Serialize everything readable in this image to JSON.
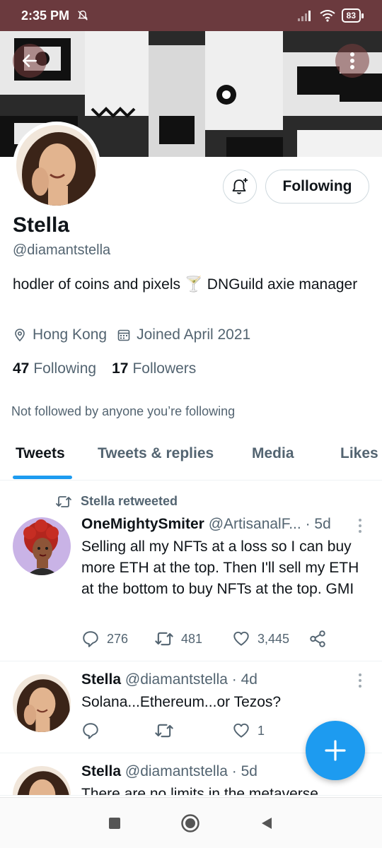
{
  "status_bar": {
    "time": "2:35 PM",
    "battery": "83"
  },
  "profile": {
    "name": "Stella",
    "handle": "@diamantstella",
    "bio": "hodler of coins and pixels 🍸 DNGuild axie manager",
    "location": "Hong Kong",
    "joined": "Joined April 2021",
    "following_count": "47",
    "following_label": "Following",
    "followers_count": "17",
    "followers_label": "Followers",
    "not_followed_note": "Not followed by anyone you’re following",
    "follow_button_label": "Following"
  },
  "tabs": [
    {
      "label": "Tweets",
      "active": true
    },
    {
      "label": "Tweets & replies",
      "active": false
    },
    {
      "label": "Media",
      "active": false
    },
    {
      "label": "Likes",
      "active": false
    }
  ],
  "tweets": [
    {
      "retweet_note": "Stella retweeted",
      "author": "OneMightySmiter",
      "handle": "@ArtisanalF...",
      "separator": "·",
      "time": "5d",
      "text": "Selling all my NFTs at a loss so I can buy more ETH at the top. Then I'll sell my ETH at the bottom to buy NFTs at the top. GMI",
      "replies": "276",
      "retweets": "481",
      "likes": "3,445"
    },
    {
      "author": "Stella",
      "handle": "@diamantstella",
      "separator": "·",
      "time": "4d",
      "text": "Solana...Ethereum...or Tezos?",
      "replies": "",
      "retweets": "",
      "likes": "1"
    },
    {
      "author": "Stella",
      "handle": "@diamantstella",
      "separator": "·",
      "time": "5d",
      "text": "There are no limits in the metaverse"
    }
  ],
  "colors": {
    "accent": "#1d9bf0",
    "status_bar": "#6b3a3e",
    "secondary_text": "#536471"
  },
  "icons": [
    "back-arrow-icon",
    "more-vertical-icon",
    "bell-plus-icon",
    "location-pin-icon",
    "calendar-icon",
    "retweet-icon",
    "reply-icon",
    "like-icon",
    "share-icon",
    "compose-plus-icon",
    "nav-recents-icon",
    "nav-home-icon",
    "nav-back-icon"
  ]
}
